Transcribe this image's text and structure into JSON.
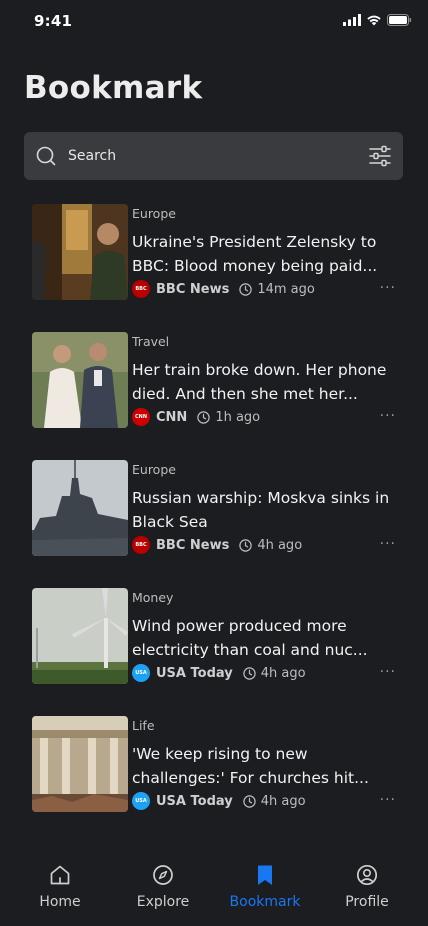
{
  "status_bar": {
    "time": "9:41"
  },
  "page_title": "Bookmark",
  "search": {
    "placeholder": "Search"
  },
  "colors": {
    "accent": "#1877f2",
    "background": "#1c1d21",
    "search_bg": "#3a3b3f"
  },
  "articles": [
    {
      "category": "Europe",
      "headline": "Ukraine's President Zelensky to BBC: Blood money being paid...",
      "source": "BBC News",
      "source_logo": "bbc-news-logo",
      "time_ago": "14m ago"
    },
    {
      "category": "Travel",
      "headline": "Her train broke down. Her phone died. And then she met her...",
      "source": "CNN",
      "source_logo": "cnn-logo",
      "time_ago": "1h ago"
    },
    {
      "category": "Europe",
      "headline": "Russian warship: Moskva sinks in Black Sea",
      "source": "BBC News",
      "source_logo": "bbc-news-logo",
      "time_ago": "4h ago"
    },
    {
      "category": "Money",
      "headline": "Wind power produced more electricity than coal and nuc...",
      "source": "USA Today",
      "source_logo": "usa-today-logo",
      "time_ago": "4h ago"
    },
    {
      "category": "Life",
      "headline": "'We keep rising to new challenges:' For churches hit...",
      "source": "USA Today",
      "source_logo": "usa-today-logo",
      "time_ago": "4h ago"
    }
  ],
  "tab_bar": {
    "items": [
      {
        "label": "Home",
        "icon": "home-icon"
      },
      {
        "label": "Explore",
        "icon": "compass-icon"
      },
      {
        "label": "Bookmark",
        "icon": "bookmark-icon",
        "active": true
      },
      {
        "label": "Profile",
        "icon": "profile-icon"
      }
    ]
  }
}
